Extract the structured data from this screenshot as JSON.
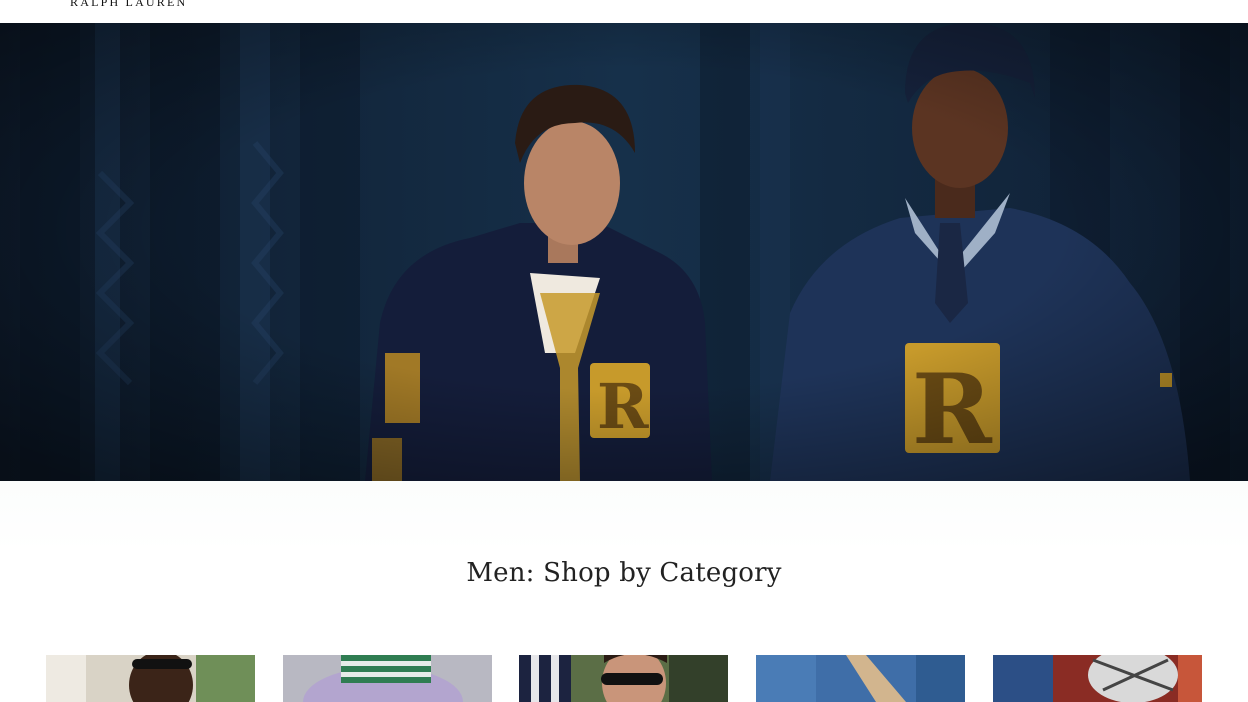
{
  "header": {
    "logo_text": "RALPH LAUREN"
  },
  "hero": {
    "image_label": "Two models in navy varsity jacket and navy sweater with gold R patches",
    "colors": {
      "backdrop": "#12233a",
      "patch": "#c79a2b"
    }
  },
  "category_section": {
    "title": "Men: Shop by Category",
    "tiles": [
      {
        "image_label": "Man with sunglasses"
      },
      {
        "image_label": "Lavender knit with striped hat"
      },
      {
        "image_label": "Man with sunglasses in striped shirt"
      },
      {
        "image_label": "Denim jacket"
      },
      {
        "image_label": "Sneakers"
      }
    ]
  }
}
